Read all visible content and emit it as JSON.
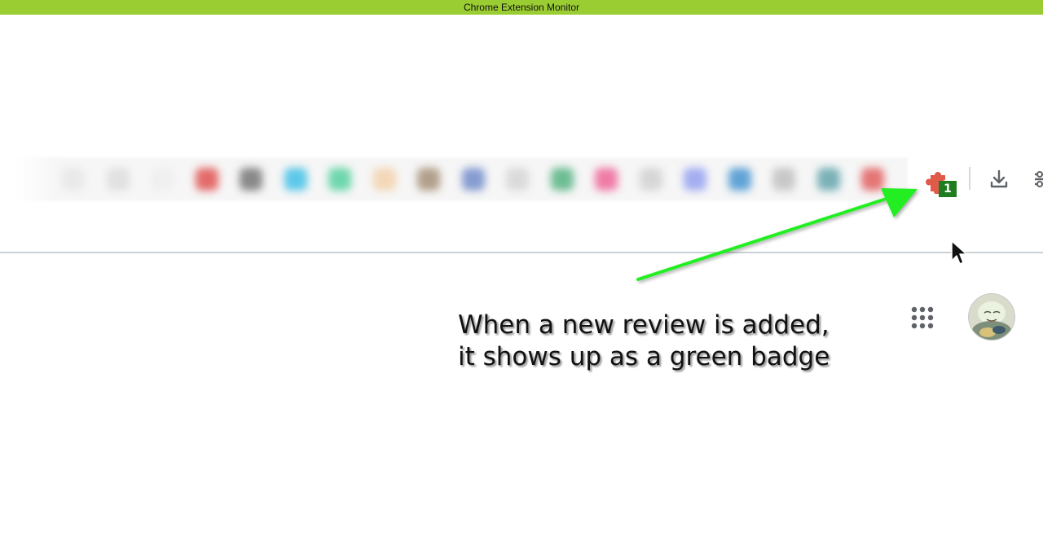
{
  "window": {
    "title": "Chrome Extension Monitor"
  },
  "toolbar": {
    "extension_badge_count": "1",
    "badge_color": "#1e7d1e",
    "extension_icon_color": "#e05a4a",
    "titlebar_color": "#9acd32",
    "blurred_icon_colors": [
      "#e6e6e6",
      "#dcdcdc",
      "#eeeeee",
      "#e04848",
      "#6e6e6e",
      "#36bde6",
      "#4ccf9a",
      "#f3d0a8",
      "#a08a70",
      "#6a86c8",
      "#d4d4d4",
      "#4caf7a",
      "#ee5d92",
      "#cfcfcf",
      "#8f9cf0",
      "#3c8fcf",
      "#bdbdbd",
      "#5aa0a8",
      "#e05555"
    ],
    "icons": {
      "extensions": "puzzle-icon",
      "downloads": "download-icon",
      "menu": "menu-icon"
    }
  },
  "page": {
    "icons": {
      "apps": "apps-grid-icon",
      "profile": "avatar"
    }
  },
  "annotation": {
    "line1": "When a new review is added,",
    "line2": "it shows up as a green badge",
    "arrow_color": "#22ee22"
  }
}
